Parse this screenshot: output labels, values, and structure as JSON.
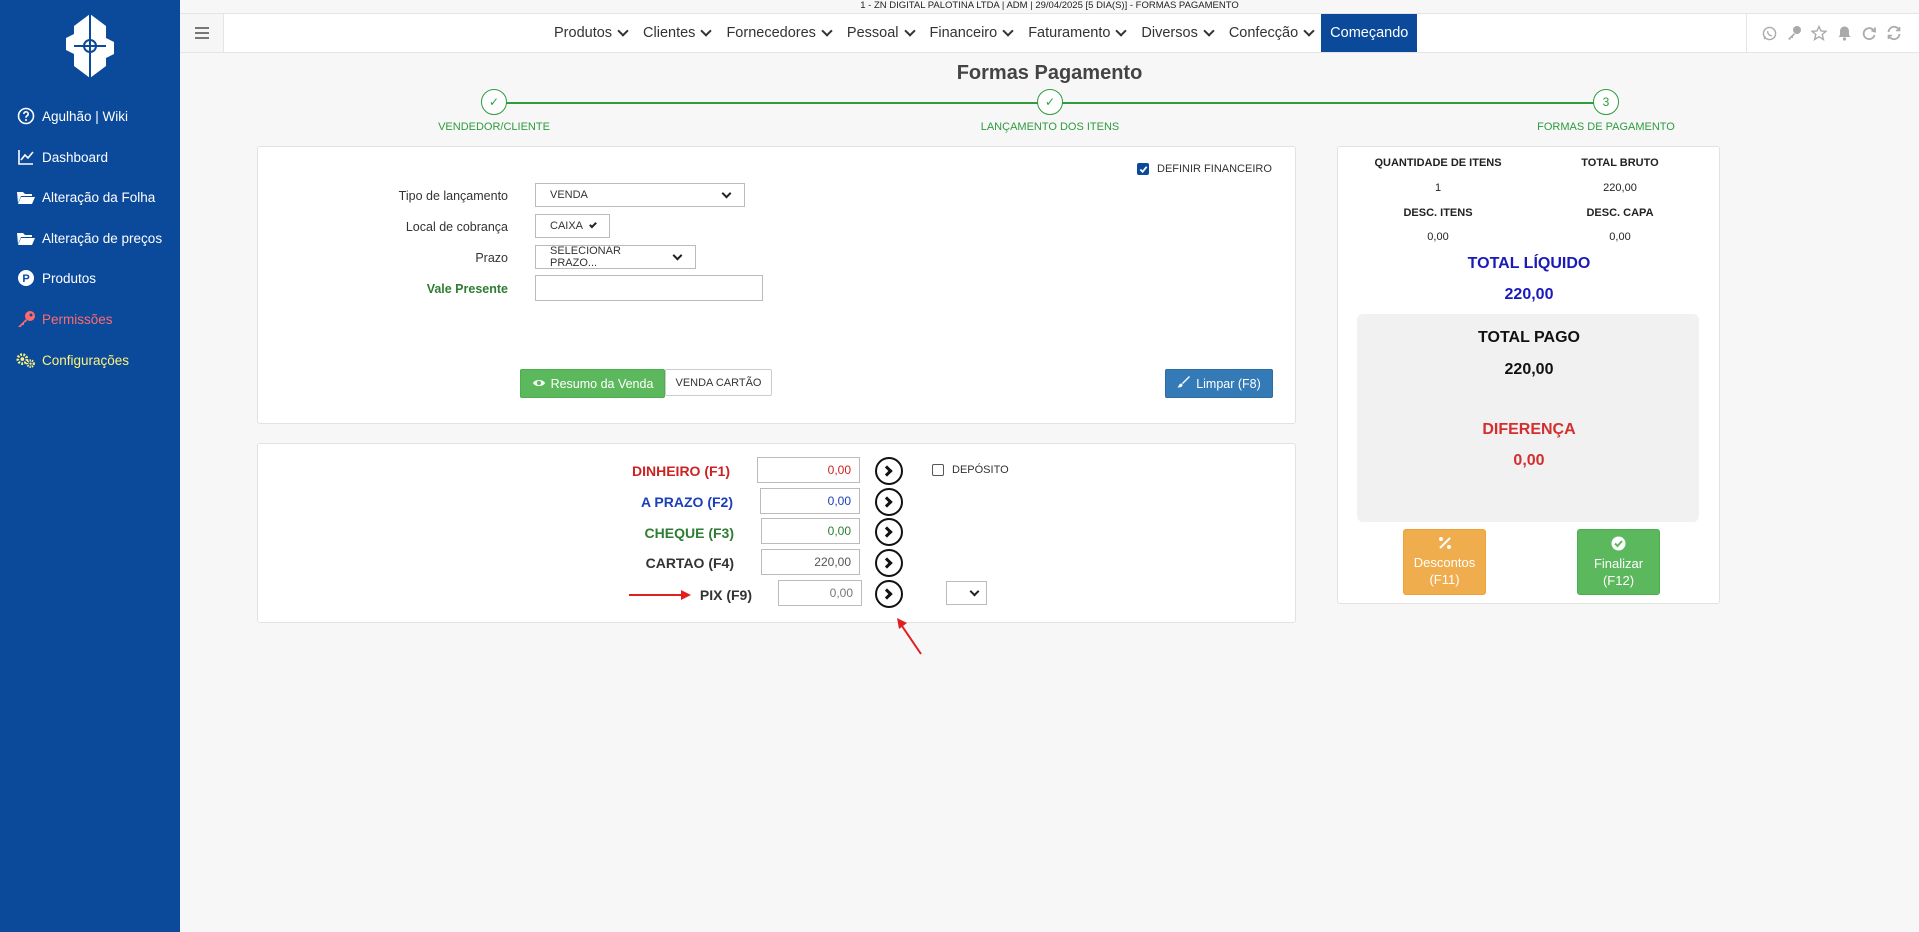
{
  "topbar": {
    "info": "1 - ZN DIGITAL PALOTINA LTDA    | ADM | 29/04/2025 [5 DIA(S)] - FORMAS PAGAMENTO"
  },
  "sidebar": {
    "items": [
      {
        "label": "Agulhão | Wiki",
        "icon": "help-circle-icon"
      },
      {
        "label": "Dashboard",
        "icon": "line-chart-icon"
      },
      {
        "label": "Alteração da Folha",
        "icon": "folder-open-icon"
      },
      {
        "label": "Alteração de preços",
        "icon": "folder-open-icon"
      },
      {
        "label": "Produtos",
        "icon": "product-p-icon"
      },
      {
        "label": "Permissões",
        "icon": "key-icon"
      },
      {
        "label": "Configurações",
        "icon": "gears-icon"
      }
    ]
  },
  "navbar": {
    "menu": [
      "Produtos",
      "Clientes",
      "Fornecedores",
      "Pessoal",
      "Financeiro",
      "Faturamento",
      "Diversos",
      "Confecção"
    ],
    "active": "Começando",
    "right_icons": [
      "whatsapp-icon",
      "key-icon",
      "star-icon",
      "bell-icon",
      "refresh-icon",
      "sync-icon"
    ]
  },
  "page": {
    "title": "Formas Pagamento"
  },
  "stepper": {
    "steps": [
      {
        "label": "VENDEDOR/CLIENTE",
        "mark": "✓"
      },
      {
        "label": "LANÇAMENTO DOS ITENS",
        "mark": "✓"
      },
      {
        "label": "FORMAS DE PAGAMENTO",
        "mark": "3"
      }
    ]
  },
  "form": {
    "definir_financeiro": {
      "label": "DEFINIR FINANCEIRO",
      "checked": true
    },
    "tipo_lancamento": {
      "label": "Tipo de lançamento",
      "value": "VENDA"
    },
    "local_cobranca": {
      "label": "Local de cobrança",
      "value": "CAIXA"
    },
    "prazo": {
      "label": "Prazo",
      "value": "SELECIONAR PRAZO..."
    },
    "vale_presente": {
      "label": "Vale Presente",
      "value": ""
    },
    "buttons": {
      "resumo": "Resumo da Venda",
      "venda_cartao": "VENDA CARTÃO",
      "limpar": "Limpar (F8)"
    }
  },
  "payments": {
    "dinheiro": {
      "label": "DINHEIRO (F1)",
      "value": "0,00",
      "color": "#cc2222"
    },
    "deposito": {
      "label": "DEPÓSITO",
      "checked": false
    },
    "a_prazo": {
      "label": "A PRAZO (F2)",
      "value": "0,00",
      "color": "#1a3fb8"
    },
    "cheque": {
      "label": "CHEQUE (F3)",
      "value": "0,00",
      "color": "#2e7d32"
    },
    "cartao": {
      "label": "CARTAO (F4)",
      "value": "220,00",
      "color": "#333333"
    },
    "pix": {
      "label": "PIX (F9)",
      "value": "0,00",
      "color": "#333333",
      "select_value": ""
    }
  },
  "summary": {
    "qtd_itens": {
      "label": "QUANTIDADE DE ITENS",
      "value": "1"
    },
    "total_bruto": {
      "label": "TOTAL BRUTO",
      "value": "220,00"
    },
    "desc_itens": {
      "label": "DESC. ITENS",
      "value": "0,00"
    },
    "desc_capa": {
      "label": "DESC. CAPA",
      "value": "0,00"
    },
    "total_liquido": {
      "label": "TOTAL LÍQUIDO",
      "value": "220,00",
      "color": "#1a1ab8"
    },
    "total_pago": {
      "label": "TOTAL PAGO",
      "value": "220,00"
    },
    "diferenca": {
      "label": "DIFERENÇA",
      "value": "0,00",
      "color": "#d32f2f"
    },
    "descontos_button": {
      "line1": "Descontos",
      "line2": "(F11)"
    },
    "finalizar_button": {
      "line1": "Finalizar",
      "line2": "(F12)"
    }
  },
  "colors": {
    "sidebar": "#0b4a9b",
    "accent_green": "#2e9b3e",
    "annotation_arrow": "#e02020"
  }
}
